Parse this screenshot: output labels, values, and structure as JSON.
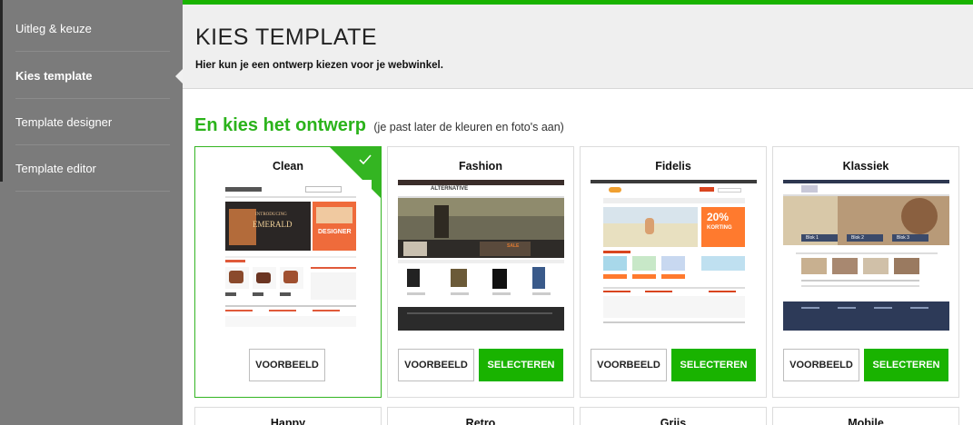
{
  "sidebar": {
    "items": [
      {
        "label": "Uitleg & keuze"
      },
      {
        "label": "Kies template"
      },
      {
        "label": "Template designer"
      },
      {
        "label": "Template editor"
      }
    ]
  },
  "header": {
    "title": "KIES TEMPLATE",
    "subtitle": "Hier kun je een ontwerp kiezen voor je webwinkel."
  },
  "section": {
    "title": "En kies het ontwerp",
    "note": "(je past later de kleuren en foto's aan)"
  },
  "templates": [
    {
      "name": "Clean",
      "preview_label": "VOORBEELD"
    },
    {
      "name": "Fashion",
      "preview_label": "VOORBEELD",
      "select_label": "SELECTEREN"
    },
    {
      "name": "Fidelis",
      "preview_label": "VOORBEELD",
      "select_label": "SELECTEREN"
    },
    {
      "name": "Klassiek",
      "preview_label": "VOORBEELD",
      "select_label": "SELECTEREN"
    }
  ],
  "templates_row2": [
    {
      "name": "Happy"
    },
    {
      "name": "Retro"
    },
    {
      "name": "Grijs"
    },
    {
      "name": "Mobile"
    }
  ],
  "thumbs": {
    "clean": {
      "banner_line1": "INTRODUCING",
      "banner_line2": "EMERALD",
      "banner_right": "DESIGNER"
    },
    "fashion": {
      "logo": "ALTERNATIVE"
    },
    "fidelis": {
      "promo": "20%",
      "promo_sub": "KORTING"
    },
    "klassiek": {
      "tab1": "Blok 1",
      "tab2": "Blok 2",
      "tab3": "Blok 3"
    }
  },
  "colors": {
    "accent": "#19b300",
    "sidebar": "#7b7b7b",
    "header_bg": "#efefef"
  }
}
